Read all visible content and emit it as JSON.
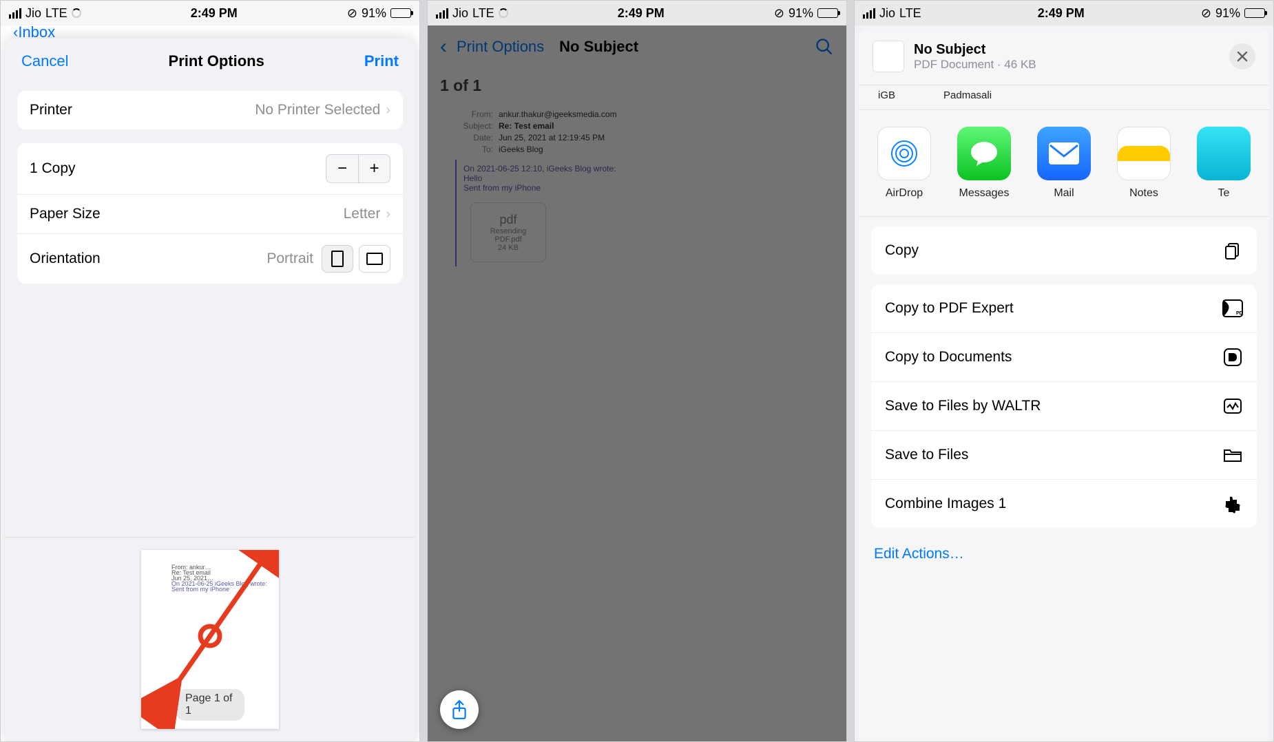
{
  "status": {
    "carrier": "Jio",
    "network": "LTE",
    "time": "2:49 PM",
    "battery_pct": "91%"
  },
  "screen1": {
    "nav_peek_back": "Inbox",
    "cancel": "Cancel",
    "title": "Print Options",
    "action": "Print",
    "printer_label": "Printer",
    "printer_value": "No Printer Selected",
    "copies_label": "1 Copy",
    "paper_label": "Paper Size",
    "paper_value": "Letter",
    "orientation_label": "Orientation",
    "orientation_value": "Portrait",
    "page_num": "Page 1 of 1"
  },
  "screen2": {
    "back": "Print Options",
    "title": "No Subject",
    "page_indicator": "1 of 1",
    "from_label": "From:",
    "from_value": "ankur.thakur@igeeksmedia.com",
    "subject_label": "Subject:",
    "subject_value": "Re: Test email",
    "date_label": "Date:",
    "date_value": "Jun 25, 2021 at 12:19:45 PM",
    "to_label": "To:",
    "to_value": "iGeeks Blog",
    "quoted_meta": "On 2021-06-25 12:10, iGeeks Blog wrote:",
    "quoted_greeting": "Hello",
    "quoted_sig": "Sent from my iPhone",
    "attach_name": "Resending PDF.pdf",
    "attach_size": "24 KB"
  },
  "screen3": {
    "title": "No Subject",
    "subtitle": "PDF Document · 46 KB",
    "contacts": {
      "c1": "iGB",
      "c2": "Padmasali"
    },
    "apps": {
      "airdrop": "AirDrop",
      "messages": "Messages",
      "mail": "Mail",
      "notes": "Notes",
      "next": "Te"
    },
    "actions": {
      "copy": "Copy",
      "pdf_expert": "Copy to PDF Expert",
      "documents": "Copy to Documents",
      "waltr": "Save to Files by WALTR",
      "save_files": "Save to Files",
      "combine": "Combine Images 1"
    },
    "edit_actions": "Edit Actions…"
  }
}
